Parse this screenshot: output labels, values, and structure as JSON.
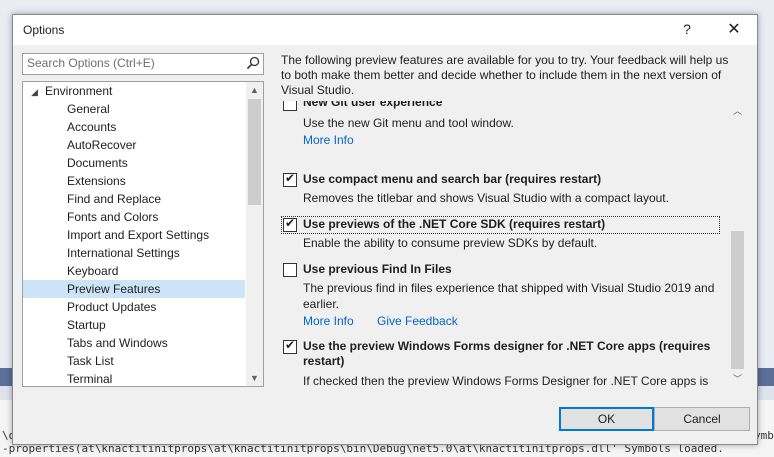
{
  "dialog": {
    "title": "Options",
    "help_label": "?",
    "close_label": "✕"
  },
  "search": {
    "placeholder": "Search Options (Ctrl+E)",
    "icon": "search-icon"
  },
  "tree": {
    "root": "Environment",
    "items": [
      "General",
      "Accounts",
      "AutoRecover",
      "Documents",
      "Extensions",
      "Find and Replace",
      "Fonts and Colors",
      "Import and Export Settings",
      "International Settings",
      "Keyboard",
      "Preview Features",
      "Product Updates",
      "Startup",
      "Tabs and Windows",
      "Task List",
      "Terminal"
    ],
    "selected": "Preview Features"
  },
  "panel": {
    "intro": "The following preview features are available for you to try. Your feedback will help us to both make them better and decide whether to include them in the next version of Visual Studio.",
    "features": [
      {
        "title": "New Git user experience",
        "checked": false,
        "description": "Use the new Git menu and tool window.",
        "links": [
          "More Info"
        ]
      },
      {
        "title": "Use compact menu and search bar (requires restart)",
        "checked": true,
        "description": "Removes the titlebar and shows Visual Studio with a compact layout.",
        "links": []
      },
      {
        "title": "Use previews of the .NET Core SDK (requires restart)",
        "checked": true,
        "description": "Enable the ability to consume preview SDKs by default.",
        "links": []
      },
      {
        "title": "Use previous Find In Files",
        "checked": false,
        "description": "The previous find in files experience that shipped with Visual Studio 2019 and earlier.",
        "links": [
          "More Info",
          "Give Feedback"
        ]
      },
      {
        "title": "Use the preview Windows Forms designer for .NET Core apps (requires restart)",
        "checked": true,
        "description": "If checked then the preview Windows Forms Designer for .NET Core apps is used.",
        "links": []
      }
    ]
  },
  "buttons": {
    "ok": "OK",
    "cancel": "Cancel"
  },
  "background": {
    "line1": "\\d",
    "line1_right": "ymb",
    "line2": "-properties(at\\knactitinitprops\\at\\knactitinitprops\\bin\\Debug\\net5.0\\at\\knactitinitprops.dll' Symbols loaded."
  },
  "colors": {
    "accent": "#0078d7",
    "link": "#0066cc",
    "selection": "#cce4f7"
  }
}
